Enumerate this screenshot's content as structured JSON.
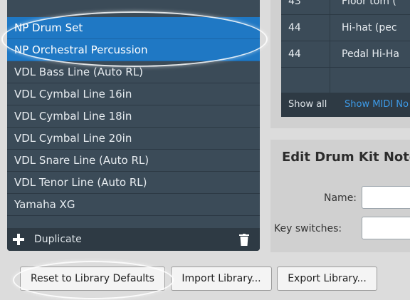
{
  "library_list": {
    "items": [
      {
        "label": "NP Drum Set",
        "selected": true
      },
      {
        "label": "NP Orchestral Percussion",
        "selected": true
      },
      {
        "label": "VDL Bass Line (Auto RL)",
        "selected": false
      },
      {
        "label": "VDL Cymbal Line 16in",
        "selected": false
      },
      {
        "label": "VDL Cymbal Line 18in",
        "selected": false
      },
      {
        "label": "VDL Cymbal Line 20in",
        "selected": false
      },
      {
        "label": "VDL Snare Line (Auto RL)",
        "selected": false
      },
      {
        "label": "VDL Tenor Line (Auto RL)",
        "selected": false
      },
      {
        "label": "Yamaha XG",
        "selected": false
      }
    ],
    "footer": {
      "duplicate_label": "Duplicate",
      "add_icon": "plus-icon",
      "delete_icon": "trash-icon"
    }
  },
  "notes_table": {
    "rows": [
      {
        "number": "43",
        "name": "Floor tom ("
      },
      {
        "number": "44",
        "name": "Hi-hat (pec"
      },
      {
        "number": "44",
        "name": "Pedal Hi-Ha"
      }
    ],
    "footer": {
      "show_all": "Show all",
      "show_midi": "Show MIDI No"
    }
  },
  "edit_panel": {
    "title": "Edit Drum Kit Note",
    "name_label": "Name:",
    "key_switches_label": "Key switches:"
  },
  "buttons": {
    "reset": "Reset to Library Defaults",
    "import": "Import Library...",
    "export": "Export Library..."
  },
  "colors": {
    "selection": "#1f78c4",
    "list_bg": "#3b4b58",
    "link": "#3d9be9"
  }
}
